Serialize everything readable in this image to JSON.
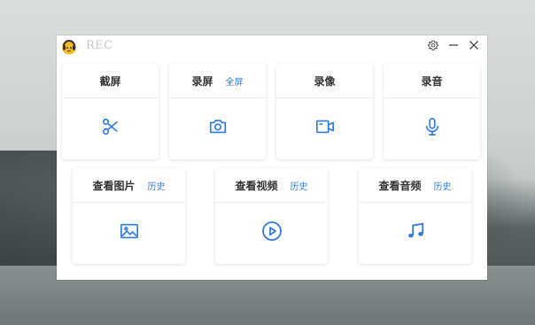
{
  "app": {
    "title": "REC"
  },
  "titlebar": {
    "settings_icon": "gear-icon",
    "minimize_icon": "minimize-icon",
    "close_icon": "close-icon"
  },
  "row1": [
    {
      "title": "截屏",
      "link": "",
      "icon": "scissors-icon"
    },
    {
      "title": "录屏",
      "link": "全屏",
      "icon": "camera-icon"
    },
    {
      "title": "录像",
      "link": "",
      "icon": "video-camera-icon"
    },
    {
      "title": "录音",
      "link": "",
      "icon": "microphone-icon"
    }
  ],
  "row2": [
    {
      "title": "查看图片",
      "link": "历史",
      "icon": "image-icon"
    },
    {
      "title": "查看视频",
      "link": "历史",
      "icon": "play-circle-icon"
    },
    {
      "title": "查看音频",
      "link": "历史",
      "icon": "music-note-icon"
    }
  ],
  "colors": {
    "accent": "#2f7be5"
  }
}
